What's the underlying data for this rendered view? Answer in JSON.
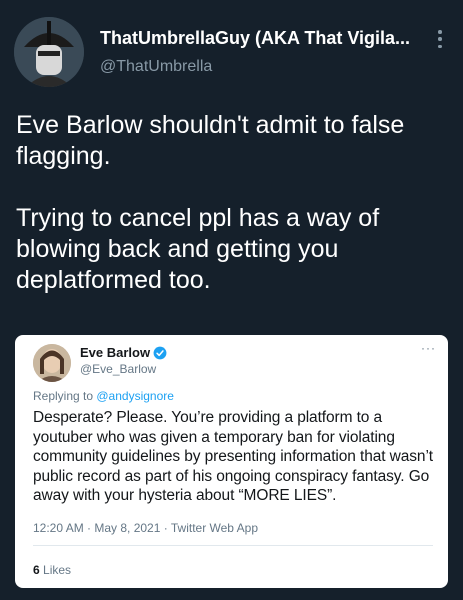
{
  "tweet": {
    "display_name": "ThatUmbrellaGuy (AKA That Vigila...",
    "handle": "@ThatUmbrella",
    "avatar_icon": "umbrella-man-avatar",
    "text_para1": "Eve Barlow shouldn't admit to false flagging.",
    "text_para2": "Trying to cancel ppl has a way of blowing back and getting you deplatformed too.",
    "more_icon": "vertical-dots-icon"
  },
  "embedded_tweet": {
    "display_name": "Eve Barlow",
    "handle": "@Eve_Barlow",
    "verified_icon": "verified-badge-icon",
    "more_icon": "horizontal-dots-icon",
    "more_label": "···",
    "replying_prefix": "Replying to ",
    "replying_handle": "@andysignore",
    "text": "Desperate? Please. You’re providing a platform to a youtuber who was given a temporary ban for violating community guidelines by presenting information that wasn’t public record as part of his ongoing conspiracy fantasy. Go away with your hysteria about “MORE LIES”.",
    "meta": "12:20 AM · May 8, 2021 · Twitter Web App",
    "likes_count": "6",
    "likes_label": " Likes"
  },
  "colors": {
    "background": "#15202b",
    "text_secondary": "#8899a6",
    "link_blue": "#1da1f2"
  }
}
